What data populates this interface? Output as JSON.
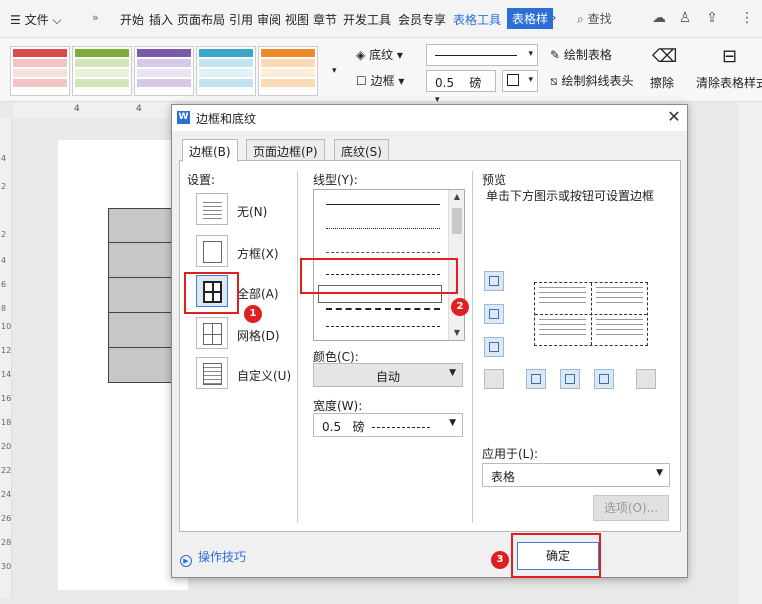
{
  "menubar": {
    "file": "文件",
    "tabs": [
      "开始",
      "插入",
      "页面布局",
      "引用",
      "审阅",
      "视图",
      "章节",
      "开发工具",
      "会员专享"
    ],
    "table_tools": "表格工具",
    "table_style": "表格样",
    "search": "查找"
  },
  "ribbon": {
    "shading": "底纹",
    "border": "边框",
    "width_value": "0.5",
    "width_unit": "磅",
    "draw_table": "绘制表格",
    "draw_diagonal": "绘制斜线表头",
    "erase": "擦除",
    "clear_style": "清除表格样式"
  },
  "dialog": {
    "title": "边框和底纹",
    "tabs": [
      "边框(B)",
      "页面边框(P)",
      "底纹(S)"
    ],
    "settings_label": "设置:",
    "settings": [
      "无(N)",
      "方框(X)",
      "全部(A)",
      "网格(D)",
      "自定义(U)"
    ],
    "line_style_label": "线型(Y):",
    "color_label": "颜色(C):",
    "color_value": "自动",
    "width_label": "宽度(W):",
    "width_value": "0.5",
    "width_unit": "磅",
    "preview_label": "预览",
    "preview_hint": "单击下方图示或按钮可设置边框",
    "apply_to_label": "应用于(L):",
    "apply_to_value": "表格",
    "options_button": "选项(O)...",
    "tips_link": "操作技巧",
    "ok_button": "确定"
  },
  "annotations": [
    "1",
    "2",
    "3"
  ],
  "ruler": {
    "h": [
      "4",
      "4"
    ],
    "v": [
      "4",
      "2",
      "2",
      "4",
      "6",
      "8",
      "10",
      "12",
      "14",
      "16",
      "18",
      "20",
      "22",
      "24",
      "26",
      "28",
      "30"
    ]
  },
  "colors": {
    "accent": "#2b6fd6",
    "annotation": "#e02020"
  }
}
